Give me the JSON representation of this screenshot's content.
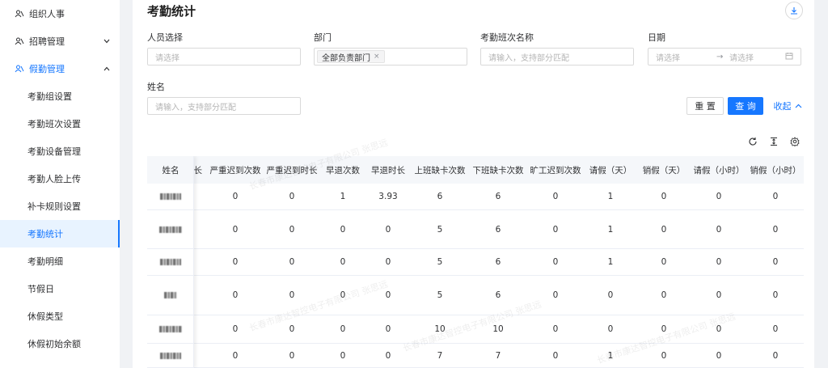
{
  "sidebar": {
    "parents": [
      {
        "label": "组织人事",
        "expanded": null
      },
      {
        "label": "招聘管理",
        "expanded": false
      },
      {
        "label": "假勤管理",
        "expanded": true
      }
    ],
    "children": [
      {
        "label": "考勤组设置"
      },
      {
        "label": "考勤班次设置"
      },
      {
        "label": "考勤设备管理"
      },
      {
        "label": "考勤人脸上传"
      },
      {
        "label": "补卡规则设置"
      },
      {
        "label": "考勤统计",
        "selected": true
      },
      {
        "label": "考勤明细"
      },
      {
        "label": "节假日"
      },
      {
        "label": "休假类型"
      },
      {
        "label": "休假初始余额"
      }
    ]
  },
  "page": {
    "title": "考勤统计"
  },
  "filters": {
    "person": {
      "label": "人员选择",
      "placeholder": "请选择"
    },
    "department": {
      "label": "部门",
      "tag": "全部负责部门",
      "tag_close": "×"
    },
    "shift": {
      "label": "考勤班次名称",
      "placeholder": "请输入，支持部分匹配"
    },
    "date": {
      "label": "日期",
      "start_placeholder": "请选择",
      "separator": "→",
      "end_placeholder": "请选择"
    },
    "name": {
      "label": "姓名",
      "placeholder": "请输入，支持部分匹配"
    }
  },
  "actions": {
    "reset": "重 置",
    "query": "查 询",
    "collapse": "收起"
  },
  "table": {
    "headers": {
      "name": "姓名",
      "clipped": "长",
      "cols": [
        "严重迟到次数",
        "严重迟到时长",
        "早退次数",
        "早退时长",
        "上班缺卡次数",
        "下班缺卡次数",
        "旷工迟到次数",
        "请假（天）",
        "销假（天）",
        "请假（小时）",
        "销假（小时）"
      ]
    },
    "rows": [
      [
        "0",
        "0",
        "1",
        "3.93",
        "6",
        "6",
        "0",
        "1",
        "0",
        "0",
        "0"
      ],
      [
        "0",
        "0",
        "0",
        "0",
        "5",
        "6",
        "0",
        "1",
        "0",
        "0",
        "0"
      ],
      [
        "0",
        "0",
        "0",
        "0",
        "5",
        "6",
        "0",
        "1",
        "0",
        "0",
        "0"
      ],
      [
        "0",
        "0",
        "0",
        "0",
        "5",
        "6",
        "0",
        "0",
        "0",
        "0",
        "0"
      ],
      [
        "0",
        "0",
        "0",
        "0",
        "10",
        "10",
        "0",
        "0",
        "0",
        "0",
        "0"
      ],
      [
        "0",
        "0",
        "0",
        "0",
        "7",
        "7",
        "0",
        "1",
        "0",
        "0",
        "0"
      ]
    ]
  },
  "watermark": "长春市康达智控电子有限公司 张思远"
}
